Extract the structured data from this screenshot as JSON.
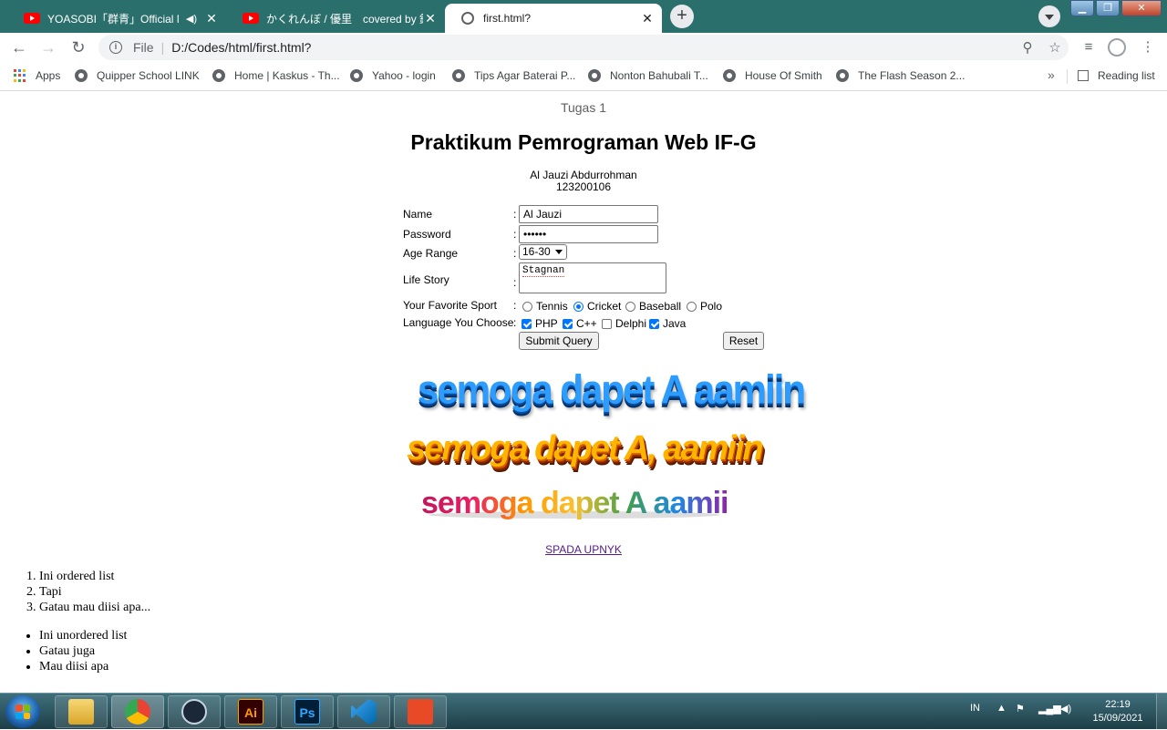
{
  "browser": {
    "tabs": [
      {
        "title": "YOASOBI「群青」Official Mu",
        "favicon": "youtube-icon",
        "audio": "speaker-icon"
      },
      {
        "title": "かくれんぼ / 優里　covered by 鈴",
        "favicon": "youtube-icon"
      },
      {
        "title": "first.html?",
        "favicon": "globe-icon"
      }
    ],
    "new_tab_symbol": "+",
    "address": {
      "scheme_label": "File",
      "separator": "|",
      "url": "D:/Codes/html/first.html?"
    },
    "bookmarks": [
      {
        "label": "Apps",
        "icon": "apps-grid-icon"
      },
      {
        "label": "Quipper School LINK"
      },
      {
        "label": "Home | Kaskus - Th..."
      },
      {
        "label": "Yahoo - login"
      },
      {
        "label": "Tips Agar Baterai P..."
      },
      {
        "label": "Nonton Bahubali T..."
      },
      {
        "label": "House Of Smith"
      },
      {
        "label": "The Flash Season 2..."
      }
    ],
    "bookmarks_more": "»",
    "reading_list": "Reading list"
  },
  "page": {
    "caption": "Tugas 1",
    "title": "Praktikum Pemrograman Web IF-G",
    "author_name": "Al Jauzi Abdurrohman",
    "author_nim": "123200106",
    "form": {
      "colon": ":",
      "name_label": "Name",
      "name_value": "Al Jauzi",
      "password_label": "Password",
      "password_value": "••••••",
      "age_label": "Age Range",
      "age_value": "16-30",
      "story_label": "Life Story",
      "story_value": "Stagnan",
      "sport_label": "Your Favorite Sport",
      "sports": [
        {
          "label": "Tennis",
          "checked": false
        },
        {
          "label": "Cricket",
          "checked": true
        },
        {
          "label": "Baseball",
          "checked": false
        },
        {
          "label": "Polo",
          "checked": false
        }
      ],
      "lang_label": "Language You Choose",
      "languages": [
        {
          "label": "PHP",
          "checked": true
        },
        {
          "label": "C++",
          "checked": true
        },
        {
          "label": "Delphi",
          "checked": false
        },
        {
          "label": "Java",
          "checked": true
        }
      ],
      "submit_label": "Submit Query",
      "reset_label": "Reset"
    },
    "wordart": [
      "semoga dapet A aamiin",
      "semoga dapet A, aamiin",
      "semoga dapet A aamiin"
    ],
    "link_text": "SPADA UPNYK",
    "ordered_list": [
      "Ini ordered list",
      "Tapi",
      "Gatau mau diisi apa..."
    ],
    "unordered_list": [
      "Ini unordered list",
      "Gatau juga",
      "Mau diisi apa"
    ]
  },
  "taskbar": {
    "apps": [
      "file-explorer-icon",
      "chrome-icon",
      "steam-icon",
      "illustrator-icon",
      "photoshop-icon",
      "vscode-icon",
      "office-icon"
    ],
    "ai_label": "Ai",
    "ps_label": "Ps",
    "language": "IN",
    "time": "22:19",
    "date": "15/09/2021"
  },
  "colors": {
    "tabstrip": "#2b6f6c",
    "checkbox_accent": "#0075ff",
    "visited_link": "#551a8b"
  }
}
